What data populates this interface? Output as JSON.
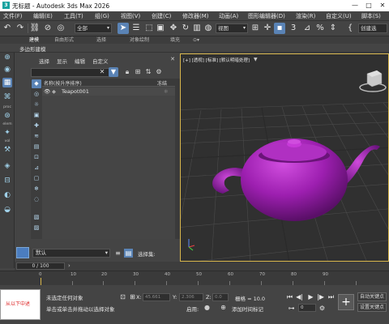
{
  "window": {
    "title": "无标题 - Autodesk 3ds Max 2026",
    "icon_letter": "3",
    "controls": [
      "—",
      "□",
      "✕"
    ]
  },
  "menubar": [
    "文件(F)",
    "编辑(E)",
    "工具(T)",
    "组(G)",
    "视图(V)",
    "创建(C)",
    "修改器(M)",
    "动画(A)",
    "图形编辑器(D)",
    "渲染(R)",
    "自定义(U)",
    "脚本(S)"
  ],
  "toolbar": {
    "selection_filter": "全部",
    "reference_coord": "视图",
    "named_selection": "创建选"
  },
  "ribbon": {
    "tabs": [
      "建模",
      "自由形式",
      "选择",
      "对象绘制",
      "填充"
    ],
    "active_tab": "建模",
    "subtab": "多边形建模"
  },
  "leftstrip": {
    "labels": [
      "proc",
      "elem",
      "vol"
    ]
  },
  "explorer": {
    "menu": [
      "选择",
      "显示",
      "编辑",
      "自定义"
    ],
    "columns": {
      "name": "名称(按升序排序)",
      "frozen": "冻结"
    },
    "rows": [
      {
        "name": "Teapot001"
      }
    ],
    "layer": "默认",
    "selection_set_label": "选择集:"
  },
  "viewport": {
    "label": "[+] [透视] [标准] [默认明暗处理]",
    "object_color": "#a020b0",
    "border_color": "#d8b64c"
  },
  "timeslider": {
    "position": "0 / 100",
    "current_frame": 0,
    "total_frames": 100
  },
  "track": {
    "ticks": [
      "0",
      "10",
      "20",
      "30",
      "40",
      "50",
      "60",
      "70",
      "80",
      "90"
    ]
  },
  "statusbar": {
    "maxscript_text": "从以下中述",
    "line1": "未选定任何对象",
    "line2": "单击或单击并拖动以选择对象",
    "coord_x_label": "X:",
    "coord_y_label": "Y:",
    "coord_z_label": "Z:",
    "coord_x_value": "45.661",
    "coord_y_value": "2.306",
    "coord_z_value": "0.0",
    "grid": "栅格 = 10.0",
    "enable_label": "启用:",
    "add_tag": "添加时间标记",
    "auto_key": "自动关键点",
    "set_key": "设置关键点",
    "frame_value": "0"
  }
}
